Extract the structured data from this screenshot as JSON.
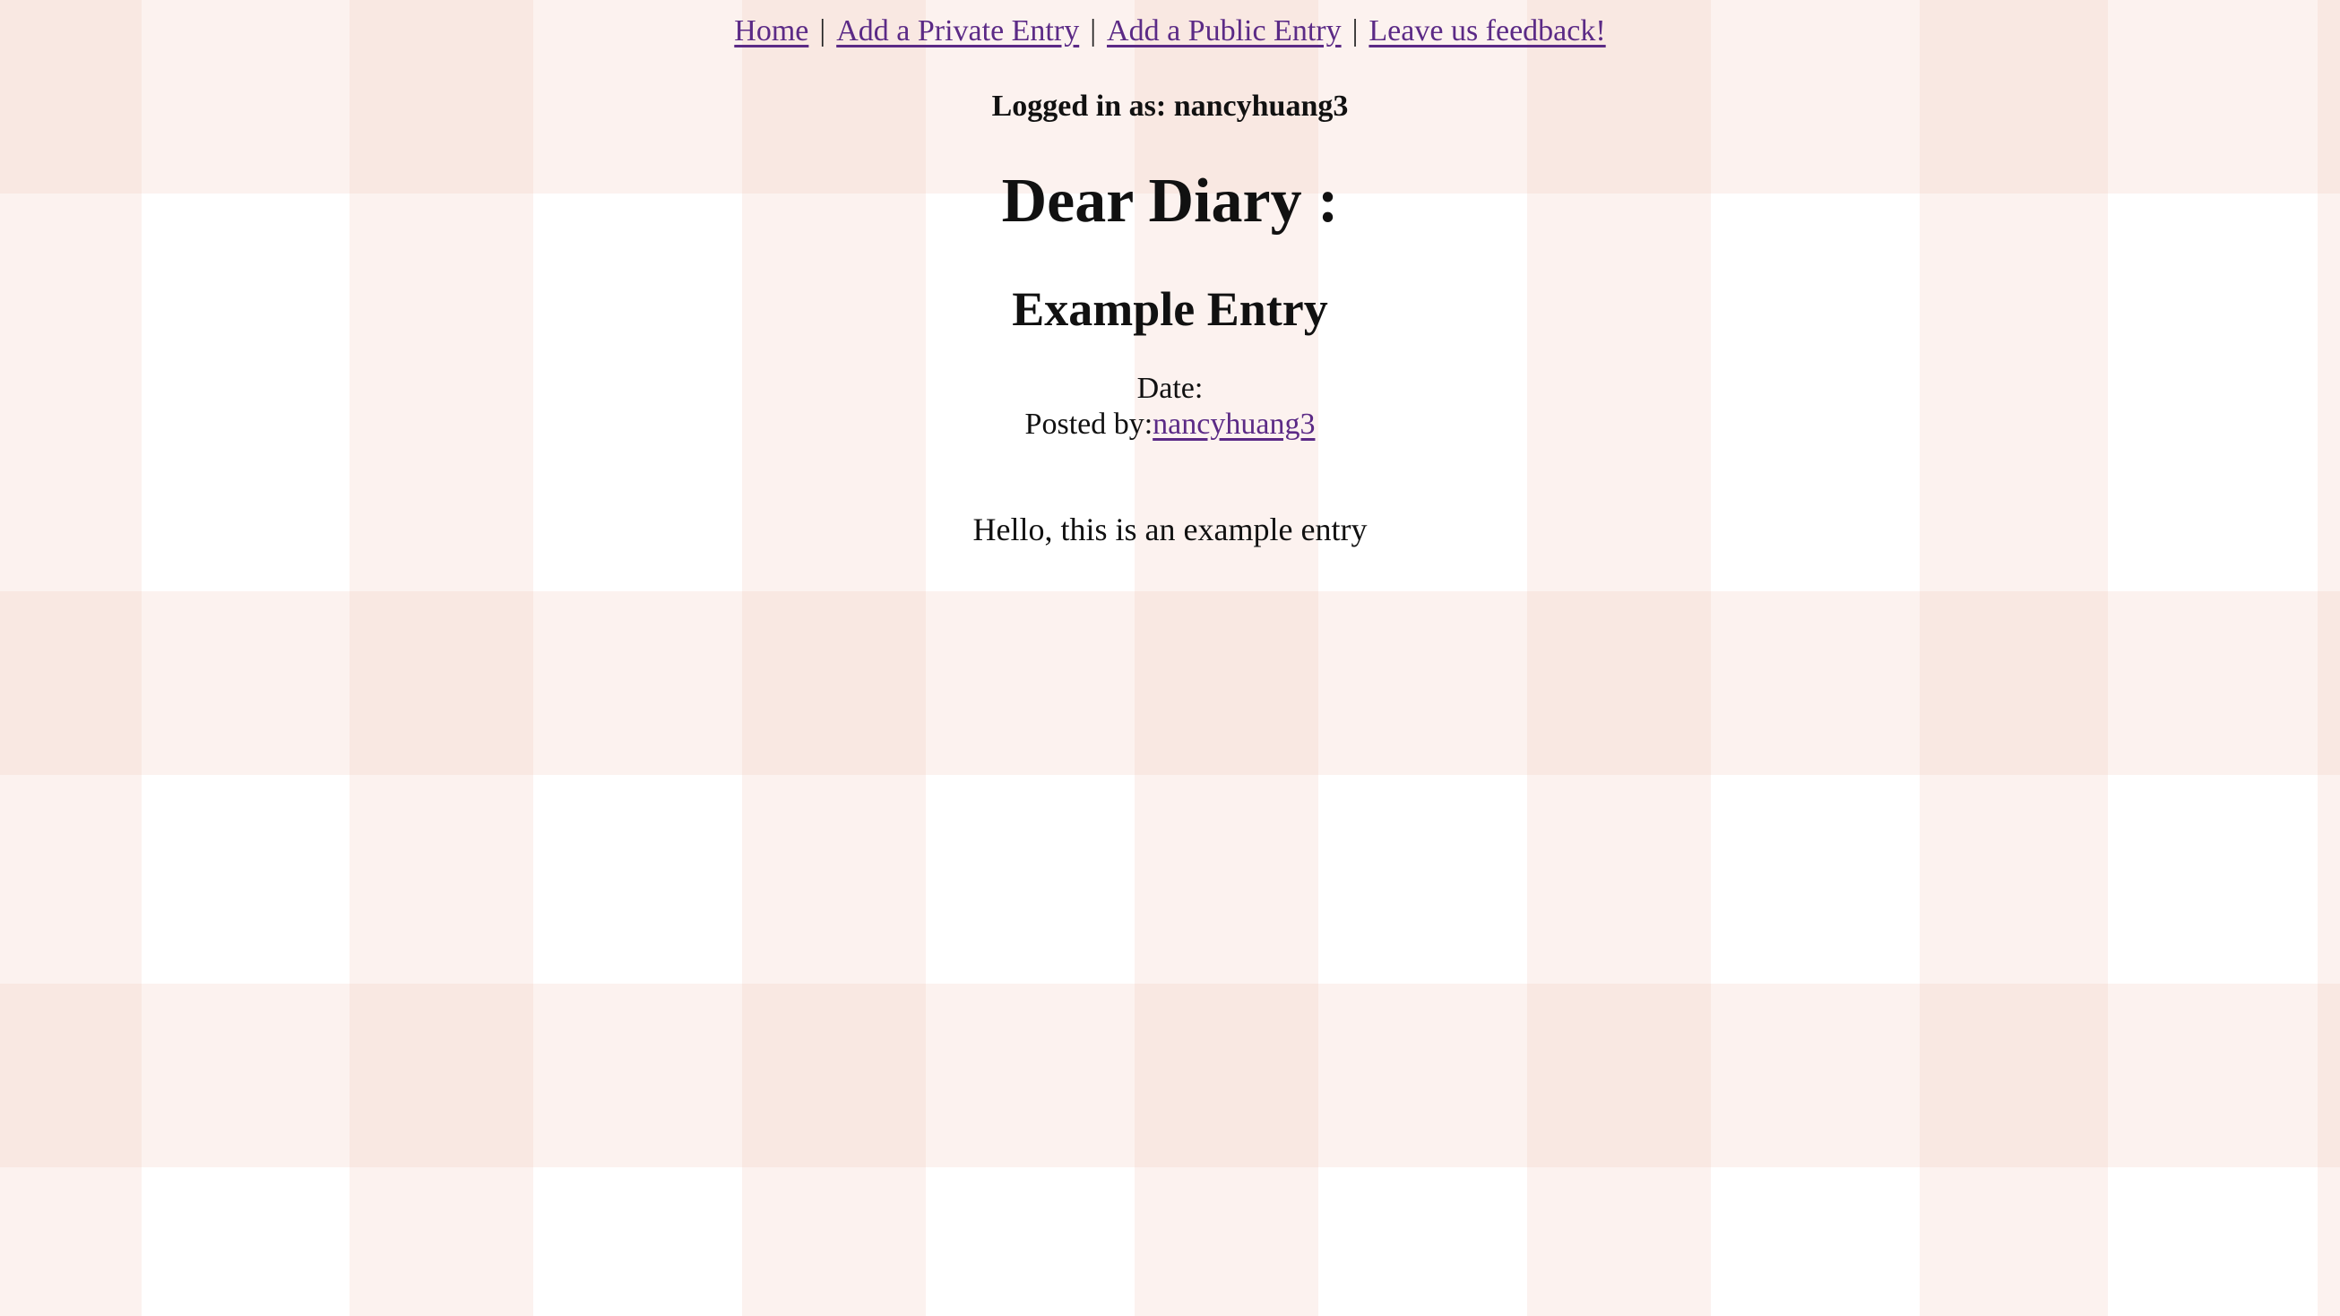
{
  "nav": {
    "links": [
      {
        "label": "Home"
      },
      {
        "label": "Add a Private Entry"
      },
      {
        "label": "Add a Public Entry"
      },
      {
        "label": "Leave us feedback!"
      }
    ],
    "separator": "|"
  },
  "session": {
    "logged_in_text": "Logged in as: nancyhuang3"
  },
  "page": {
    "heading": "Dear Diary :"
  },
  "entry": {
    "title": "Example Entry",
    "date_label": "Date:",
    "date_value": "",
    "posted_by_label": "Posted by:",
    "author": "nancyhuang3",
    "body": "Hello, this is an example entry"
  },
  "colors": {
    "link": "#5b2a86",
    "text": "#111111",
    "gingham": "#f0c4b6"
  }
}
